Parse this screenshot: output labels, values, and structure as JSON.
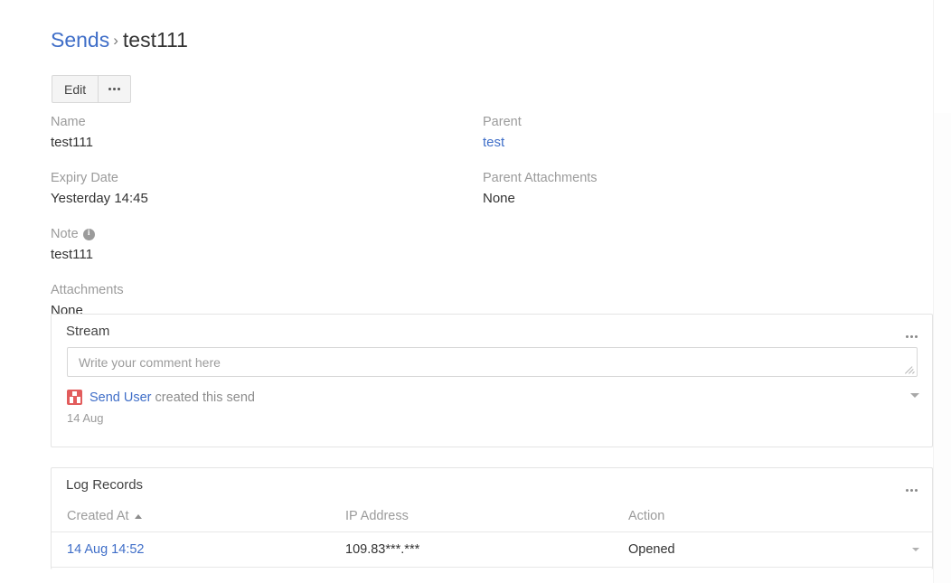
{
  "breadcrumb": {
    "parent_label": "Sends",
    "separator": "›",
    "current_label": "test111"
  },
  "toolbar": {
    "edit_label": "Edit",
    "more_label": "more-actions"
  },
  "details": {
    "left_column": [
      {
        "label": "Name",
        "value": "test111",
        "is_link": false,
        "has_info": false
      },
      {
        "label": "Expiry Date",
        "value": "Yesterday 14:45",
        "is_link": false,
        "has_info": false
      },
      {
        "label": "Note",
        "value": "test111",
        "is_link": false,
        "has_info": true
      },
      {
        "label": "Attachments",
        "value": "None",
        "is_link": false,
        "has_info": false
      }
    ],
    "right_column": [
      {
        "label": "Parent",
        "value": "test",
        "is_link": true,
        "has_info": false
      },
      {
        "label": "Parent Attachments",
        "value": "None",
        "is_link": false,
        "has_info": false
      }
    ]
  },
  "stream": {
    "title": "Stream",
    "comment_placeholder": "Write your comment here",
    "comment_value": "",
    "post": {
      "user": "Send User",
      "action_text": "created this send",
      "date": "14 Aug"
    }
  },
  "log_records": {
    "title": "Log Records",
    "columns": [
      {
        "label": "Created At",
        "sort": "asc"
      },
      {
        "label": "IP Address",
        "sort": ""
      },
      {
        "label": "Action",
        "sort": ""
      }
    ],
    "rows": [
      {
        "created_at": "14 Aug 14:52",
        "ip_address": "109.83***.***",
        "action": "Opened"
      }
    ]
  },
  "colors": {
    "link": "#3f6ec8",
    "muted_label": "#9b9b9b",
    "text": "#333333",
    "avatar": "#e25c5c",
    "panel_border": "#e4e4e4"
  }
}
